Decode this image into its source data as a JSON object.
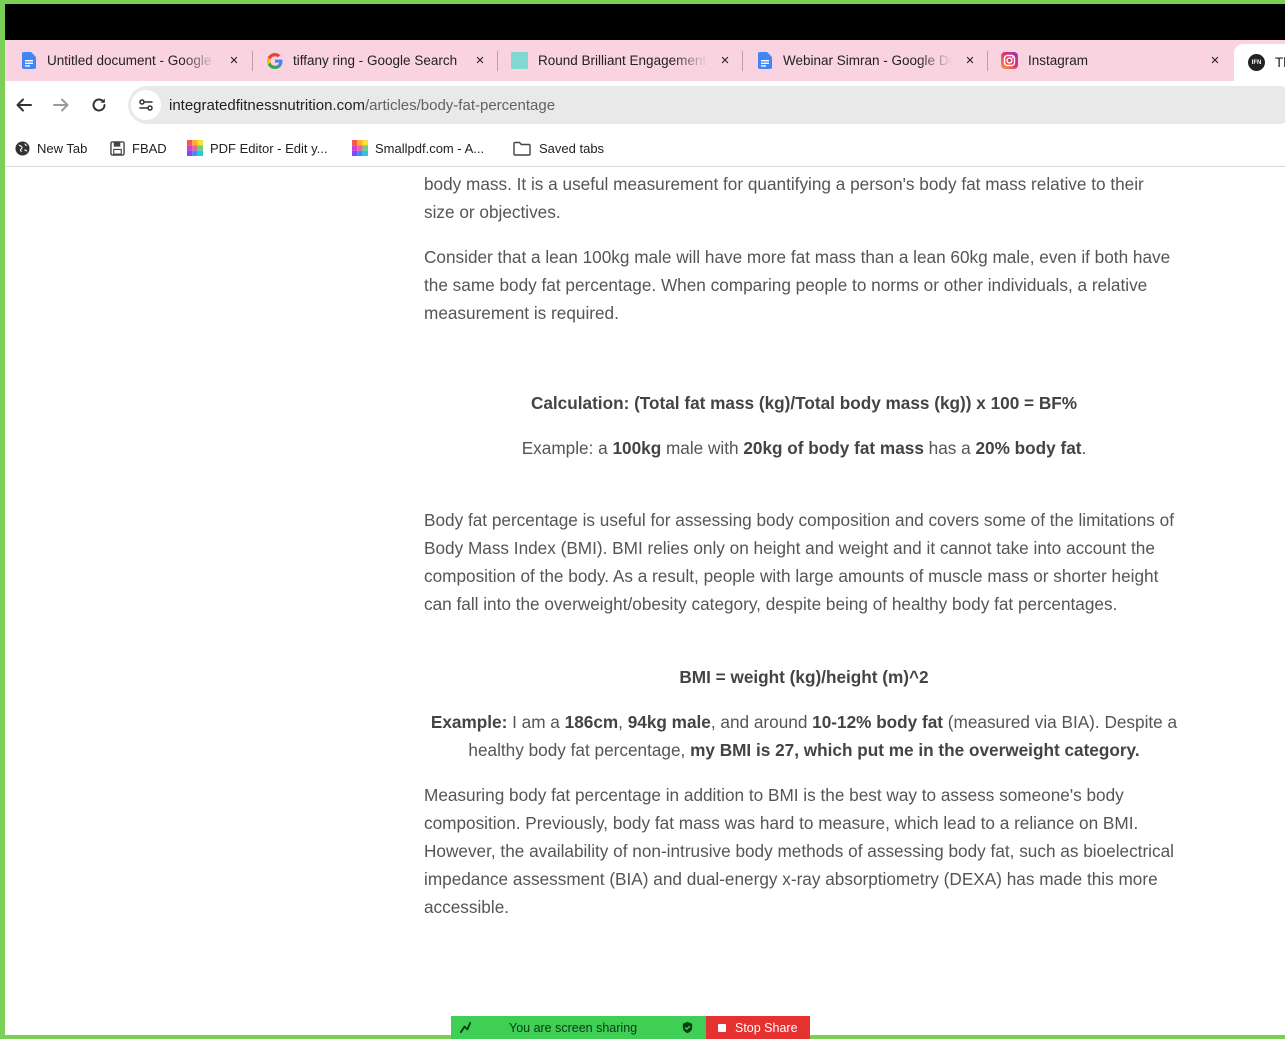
{
  "tabs": [
    {
      "title": "Untitled document - Google Docs",
      "icon": "google-docs-icon",
      "close": "×"
    },
    {
      "title": "tiffany ring - Google Search",
      "icon": "google-icon",
      "close": "×"
    },
    {
      "title": "Round Brilliant Engagement Ring",
      "icon": "tiffany-icon",
      "close": "×"
    },
    {
      "title": "Webinar Simran - Google Docs",
      "icon": "google-docs-icon",
      "close": "×"
    },
    {
      "title": "Instagram",
      "icon": "instagram-icon",
      "close": "×"
    },
    {
      "title": "The",
      "icon": "ifn-icon"
    }
  ],
  "toolbar": {
    "url_host": "integratedfitnessnutrition.com",
    "url_path": "/articles/body-fat-percentage"
  },
  "bookmarks": [
    {
      "label": "New Tab",
      "icon": "globe-icon"
    },
    {
      "label": "FBAD",
      "icon": "save-icon"
    },
    {
      "label": "PDF Editor - Edit y...",
      "icon": "smallpdf-icon"
    },
    {
      "label": "Smallpdf.com - A...",
      "icon": "smallpdf-icon"
    },
    {
      "label": "Saved tabs",
      "icon": "folder-icon"
    }
  ],
  "article": {
    "p1_line1": "body mass. It is a useful measurement for quantifying a person's body fat mass relative to their",
    "p1_line2": "size or objectives.",
    "p2": "Consider that a lean 100kg male will have more fat mass than a lean 60kg male, even if both have the same body fat percentage. When comparing people to norms or other individuals, a relative measurement is required.",
    "calculation": "Calculation: (Total fat mass (kg)/Total body mass (kg)) x 100 = BF%",
    "example1": {
      "t1": "Example: a ",
      "b1": "100kg",
      "t2": " male with ",
      "b2": "20kg of body fat mass",
      "t3": " has a ",
      "b3": "20% body fat",
      "t4": "."
    },
    "p3": "Body fat percentage is useful for assessing body composition and covers some of the limitations of Body Mass Index (BMI). BMI relies only on height and weight and it cannot take into account the composition of the body. As a result, people with large amounts of muscle mass or shorter height can fall into the overweight/obesity category, despite being of healthy body fat percentages.",
    "bmi_formula": "BMI = weight (kg)/height (m)^2",
    "example2": {
      "b1": "Example:",
      "t1": " I am a ",
      "b2": "186cm",
      "t2": ", ",
      "b3": "94kg male",
      "t3": ", and around ",
      "b4": "10-12% body fat",
      "t4": " (measured via BIA). Despite a healthy body fat percentage, ",
      "b5": "my BMI is 27, which put me in the overweight category."
    },
    "p4": "Measuring body fat percentage in addition to BMI is the best way to assess someone's body composition. Previously, body fat mass was hard to measure, which lead to a reliance on BMI. However, the availability of non-intrusive body methods of assessing body fat, such as bioelectrical impedance assessment (BIA) and dual-energy x-ray absorptiometry (DEXA) has made this more accessible."
  },
  "share_bar": {
    "status": "You are screen sharing",
    "stop": "Stop Share"
  },
  "colors": {
    "tabstrip": "#f9d3df",
    "share_green": "#3fcf55",
    "stop_red": "#e5312f",
    "frame_green": "#7ccf55"
  }
}
